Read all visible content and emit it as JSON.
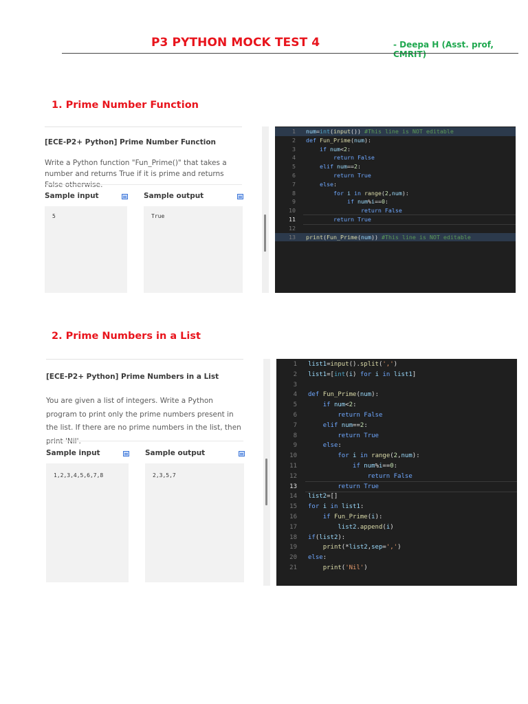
{
  "header": {
    "title": "P3 PYTHON MOCK TEST 4",
    "author": "- Deepa H (Asst. prof, CMRIT)"
  },
  "sections": [
    {
      "heading": "1. Prime Number Function",
      "problem_title": "[ECE-P2+ Python] Prime Number Function",
      "description": "Write a Python function \"Fun_Prime()\" that takes a number and returns True if it is prime and returns False otherwise.",
      "sample_input_label": "Sample input",
      "sample_output_label": "Sample output",
      "sample_input": "5",
      "sample_output": "True",
      "code": [
        {
          "n": "1",
          "t": [
            [
              "v",
              "num"
            ],
            [
              "p",
              "="
            ],
            [
              "t",
              "int"
            ],
            [
              "p",
              "("
            ],
            [
              "f",
              "input"
            ],
            [
              "p",
              "()) "
            ],
            [
              "c",
              "#This line is NOT editable"
            ]
          ]
        },
        {
          "n": "2",
          "t": [
            [
              "k",
              "def "
            ],
            [
              "f",
              "Fun_Prime"
            ],
            [
              "p",
              "("
            ],
            [
              "v",
              "num"
            ],
            [
              "p",
              "):"
            ]
          ]
        },
        {
          "n": "3",
          "t": [
            [
              "p",
              "    "
            ],
            [
              "k",
              "if "
            ],
            [
              "v",
              "num"
            ],
            [
              "p",
              "<"
            ],
            [
              "n",
              "2"
            ],
            [
              "p",
              ":"
            ]
          ]
        },
        {
          "n": "4",
          "t": [
            [
              "p",
              "        "
            ],
            [
              "k",
              "return "
            ],
            [
              "k",
              "False"
            ]
          ]
        },
        {
          "n": "5",
          "t": [
            [
              "p",
              "    "
            ],
            [
              "k",
              "elif "
            ],
            [
              "v",
              "num"
            ],
            [
              "p",
              "=="
            ],
            [
              "n",
              "2"
            ],
            [
              "p",
              ":"
            ]
          ]
        },
        {
          "n": "6",
          "t": [
            [
              "p",
              "        "
            ],
            [
              "k",
              "return "
            ],
            [
              "k",
              "True"
            ]
          ]
        },
        {
          "n": "7",
          "t": [
            [
              "p",
              "    "
            ],
            [
              "k",
              "else"
            ],
            [
              "p",
              ":"
            ]
          ]
        },
        {
          "n": "8",
          "t": [
            [
              "p",
              "        "
            ],
            [
              "k",
              "for "
            ],
            [
              "v",
              "i"
            ],
            [
              "k",
              " in "
            ],
            [
              "f",
              "range"
            ],
            [
              "p",
              "("
            ],
            [
              "n",
              "2"
            ],
            [
              "p",
              ","
            ],
            [
              "v",
              "num"
            ],
            [
              "p",
              "):"
            ]
          ]
        },
        {
          "n": "9",
          "t": [
            [
              "p",
              "            "
            ],
            [
              "k",
              "if "
            ],
            [
              "v",
              "num"
            ],
            [
              "p",
              "%"
            ],
            [
              "v",
              "i"
            ],
            [
              "p",
              "=="
            ],
            [
              "n",
              "0"
            ],
            [
              "p",
              ":"
            ]
          ]
        },
        {
          "n": "10",
          "t": [
            [
              "p",
              "                "
            ],
            [
              "k",
              "return "
            ],
            [
              "k",
              "False"
            ]
          ]
        },
        {
          "n": "11",
          "t": [
            [
              "p",
              "        "
            ],
            [
              "k",
              "return "
            ],
            [
              "k",
              "True"
            ]
          ]
        },
        {
          "n": "12",
          "t": []
        },
        {
          "n": "13",
          "t": [
            [
              "f",
              "print"
            ],
            [
              "p",
              "("
            ],
            [
              "f",
              "Fun_Prime"
            ],
            [
              "p",
              "("
            ],
            [
              "v",
              "num"
            ],
            [
              "p",
              ")) "
            ],
            [
              "c",
              "#This line is NOT editable"
            ]
          ]
        }
      ]
    },
    {
      "heading": "2. Prime Numbers in a List",
      "problem_title": "[ECE-P2+ Python] Prime Numbers in a List",
      "description": "You are given a list of integers. Write a Python program to print only the prime numbers present in the list. If there are no prime numbers in the list, then print 'Nil'.",
      "sample_input_label": "Sample input",
      "sample_output_label": "Sample output",
      "sample_input": "1,2,3,4,5,6,7,8",
      "sample_output": "2,3,5,7",
      "code": [
        {
          "n": "1",
          "t": [
            [
              "v",
              "list1"
            ],
            [
              "p",
              "="
            ],
            [
              "f",
              "input"
            ],
            [
              "p",
              "()."
            ],
            [
              "f",
              "split"
            ],
            [
              "p",
              "("
            ],
            [
              "s",
              "','"
            ],
            [
              "p",
              ")"
            ]
          ]
        },
        {
          "n": "2",
          "t": [
            [
              "v",
              "list1"
            ],
            [
              "p",
              "=["
            ],
            [
              "t",
              "int"
            ],
            [
              "p",
              "("
            ],
            [
              "v",
              "i"
            ],
            [
              "p",
              ") "
            ],
            [
              "k",
              "for "
            ],
            [
              "v",
              "i"
            ],
            [
              "k",
              " in "
            ],
            [
              "v",
              "list1"
            ],
            [
              "p",
              "]"
            ]
          ]
        },
        {
          "n": "3",
          "t": []
        },
        {
          "n": "4",
          "t": [
            [
              "k",
              "def "
            ],
            [
              "f",
              "Fun_Prime"
            ],
            [
              "p",
              "("
            ],
            [
              "v",
              "num"
            ],
            [
              "p",
              "):"
            ]
          ]
        },
        {
          "n": "5",
          "t": [
            [
              "p",
              "    "
            ],
            [
              "k",
              "if "
            ],
            [
              "v",
              "num"
            ],
            [
              "p",
              "<"
            ],
            [
              "n",
              "2"
            ],
            [
              "p",
              ":"
            ]
          ]
        },
        {
          "n": "6",
          "t": [
            [
              "p",
              "        "
            ],
            [
              "k",
              "return "
            ],
            [
              "k",
              "False"
            ]
          ]
        },
        {
          "n": "7",
          "t": [
            [
              "p",
              "    "
            ],
            [
              "k",
              "elif "
            ],
            [
              "v",
              "num"
            ],
            [
              "p",
              "=="
            ],
            [
              "n",
              "2"
            ],
            [
              "p",
              ":"
            ]
          ]
        },
        {
          "n": "8",
          "t": [
            [
              "p",
              "        "
            ],
            [
              "k",
              "return "
            ],
            [
              "k",
              "True"
            ]
          ]
        },
        {
          "n": "9",
          "t": [
            [
              "p",
              "    "
            ],
            [
              "k",
              "else"
            ],
            [
              "p",
              ":"
            ]
          ]
        },
        {
          "n": "10",
          "t": [
            [
              "p",
              "        "
            ],
            [
              "k",
              "for "
            ],
            [
              "v",
              "i"
            ],
            [
              "k",
              " in "
            ],
            [
              "f",
              "range"
            ],
            [
              "p",
              "("
            ],
            [
              "n",
              "2"
            ],
            [
              "p",
              ","
            ],
            [
              "v",
              "num"
            ],
            [
              "p",
              "):"
            ]
          ]
        },
        {
          "n": "11",
          "t": [
            [
              "p",
              "            "
            ],
            [
              "k",
              "if "
            ],
            [
              "v",
              "num"
            ],
            [
              "p",
              "%"
            ],
            [
              "v",
              "i"
            ],
            [
              "p",
              "=="
            ],
            [
              "n",
              "0"
            ],
            [
              "p",
              ":"
            ]
          ]
        },
        {
          "n": "12",
          "t": [
            [
              "p",
              "                "
            ],
            [
              "k",
              "return "
            ],
            [
              "k",
              "False"
            ]
          ]
        },
        {
          "n": "13",
          "t": [
            [
              "p",
              "        "
            ],
            [
              "k",
              "return "
            ],
            [
              "k",
              "True"
            ]
          ]
        },
        {
          "n": "14",
          "t": [
            [
              "v",
              "list2"
            ],
            [
              "p",
              "=[]"
            ]
          ]
        },
        {
          "n": "15",
          "t": [
            [
              "k",
              "for "
            ],
            [
              "v",
              "i"
            ],
            [
              "k",
              " in "
            ],
            [
              "v",
              "list1"
            ],
            [
              "p",
              ":"
            ]
          ]
        },
        {
          "n": "16",
          "t": [
            [
              "p",
              "    "
            ],
            [
              "k",
              "if "
            ],
            [
              "f",
              "Fun_Prime"
            ],
            [
              "p",
              "("
            ],
            [
              "v",
              "i"
            ],
            [
              "p",
              "):"
            ]
          ]
        },
        {
          "n": "17",
          "t": [
            [
              "p",
              "        "
            ],
            [
              "v",
              "list2"
            ],
            [
              "p",
              "."
            ],
            [
              "f",
              "append"
            ],
            [
              "p",
              "("
            ],
            [
              "v",
              "i"
            ],
            [
              "p",
              ")"
            ]
          ]
        },
        {
          "n": "18",
          "t": [
            [
              "k",
              "if"
            ],
            [
              "p",
              "("
            ],
            [
              "v",
              "list2"
            ],
            [
              "p",
              "):"
            ]
          ]
        },
        {
          "n": "19",
          "t": [
            [
              "p",
              "    "
            ],
            [
              "f",
              "print"
            ],
            [
              "p",
              "(*"
            ],
            [
              "v",
              "list2"
            ],
            [
              "p",
              ","
            ],
            [
              "v",
              "sep"
            ],
            [
              "p",
              "="
            ],
            [
              "s",
              "','"
            ],
            [
              "p",
              ")"
            ]
          ]
        },
        {
          "n": "20",
          "t": [
            [
              "k",
              "else"
            ],
            [
              "p",
              ":"
            ]
          ]
        },
        {
          "n": "21",
          "t": [
            [
              "p",
              "    "
            ],
            [
              "f",
              "print"
            ],
            [
              "p",
              "("
            ],
            [
              "s",
              "'Nil'"
            ],
            [
              "p",
              ")"
            ]
          ]
        }
      ]
    }
  ],
  "colors": {
    "heading_red": "#e8141c",
    "author_green": "#1fa84f",
    "editor_bg": "#1f1f1f"
  }
}
